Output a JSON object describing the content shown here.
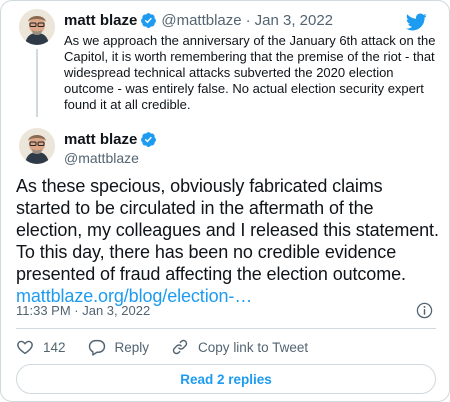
{
  "parent_tweet": {
    "name": "matt blaze",
    "handle": "@mattblaze",
    "separator": "·",
    "date": "Jan 3, 2022",
    "text": "As we approach the anniversary of the January 6th attack on the Capitol, it is worth remembering that the premise of the riot - that widespread technical attacks subverted the 2020 election outcome - was entirely false. No actual election security expert found it at all credible."
  },
  "main_tweet": {
    "name": "matt blaze",
    "handle": "@mattblaze",
    "text": "As these specious, obviously fabricated claims started to be circulated in the aftermath of the election, my colleagues and I released this statement. To this day, there has been no credible evidence presented of fraud affecting the election outcome.",
    "link": "mattblaze.org/blog/election-…",
    "timestamp": "11:33 PM · Jan 3, 2022"
  },
  "actions": {
    "like_count": "142",
    "reply_label": "Reply",
    "copy_label": "Copy link to Tweet"
  },
  "replies_button": "Read 2 replies",
  "colors": {
    "accent": "#1d9bf0",
    "like": "#536471",
    "verified": "#1d9bf0",
    "text": "#0f1419",
    "muted": "#536471",
    "border": "#cfd9de"
  },
  "icons": [
    "twitter-bird-icon",
    "verified-badge-icon",
    "info-icon",
    "heart-icon",
    "reply-icon",
    "link-icon"
  ]
}
